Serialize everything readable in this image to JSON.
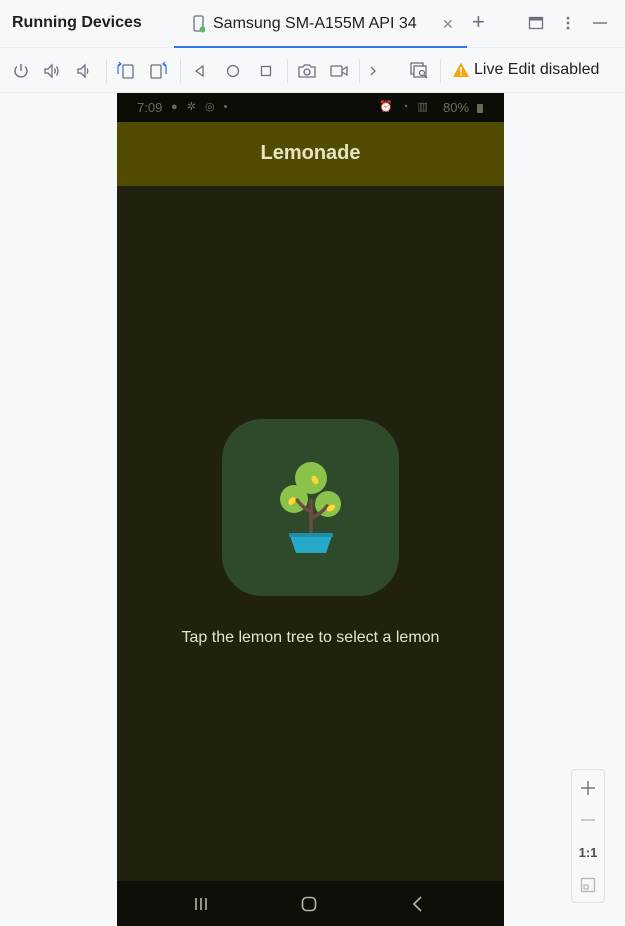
{
  "panel": {
    "title": "Running Devices"
  },
  "tabs": [
    {
      "label": "Samsung SM-A155M API 34",
      "close_icon": "close-icon",
      "active": true
    }
  ],
  "header_actions": [
    "add-tab-icon",
    "restore-window-icon",
    "more-options-icon",
    "minimize-icon"
  ],
  "toolbar": {
    "buttons": [
      "power-icon",
      "volume-up-icon",
      "volume-down-icon",
      "rotate-left-icon",
      "rotate-right-icon",
      "back-icon",
      "home-icon",
      "overview-icon",
      "screenshot-icon",
      "screen-record-icon",
      "more-actions-icon",
      "layout-inspector-icon"
    ],
    "live_edit_label": "Live Edit disabled",
    "live_edit_icon": "warning-icon",
    "warning_color": "#f2a60d"
  },
  "device": {
    "status_bar": {
      "time": "7:09",
      "battery": "80%"
    },
    "app_title": "Lemonade",
    "instruction": "Tap the lemon tree to select a lemon",
    "image_icon": "lemon-tree-icon",
    "appbar_color": "#524b02",
    "background_color": "#21210f",
    "nav_buttons": [
      "recents-icon",
      "home-icon",
      "back-icon"
    ]
  },
  "zoom": {
    "one_to_one_label": "1:1",
    "buttons": [
      "zoom-in-icon",
      "zoom-out-icon",
      "zoom-fit-icon"
    ]
  }
}
